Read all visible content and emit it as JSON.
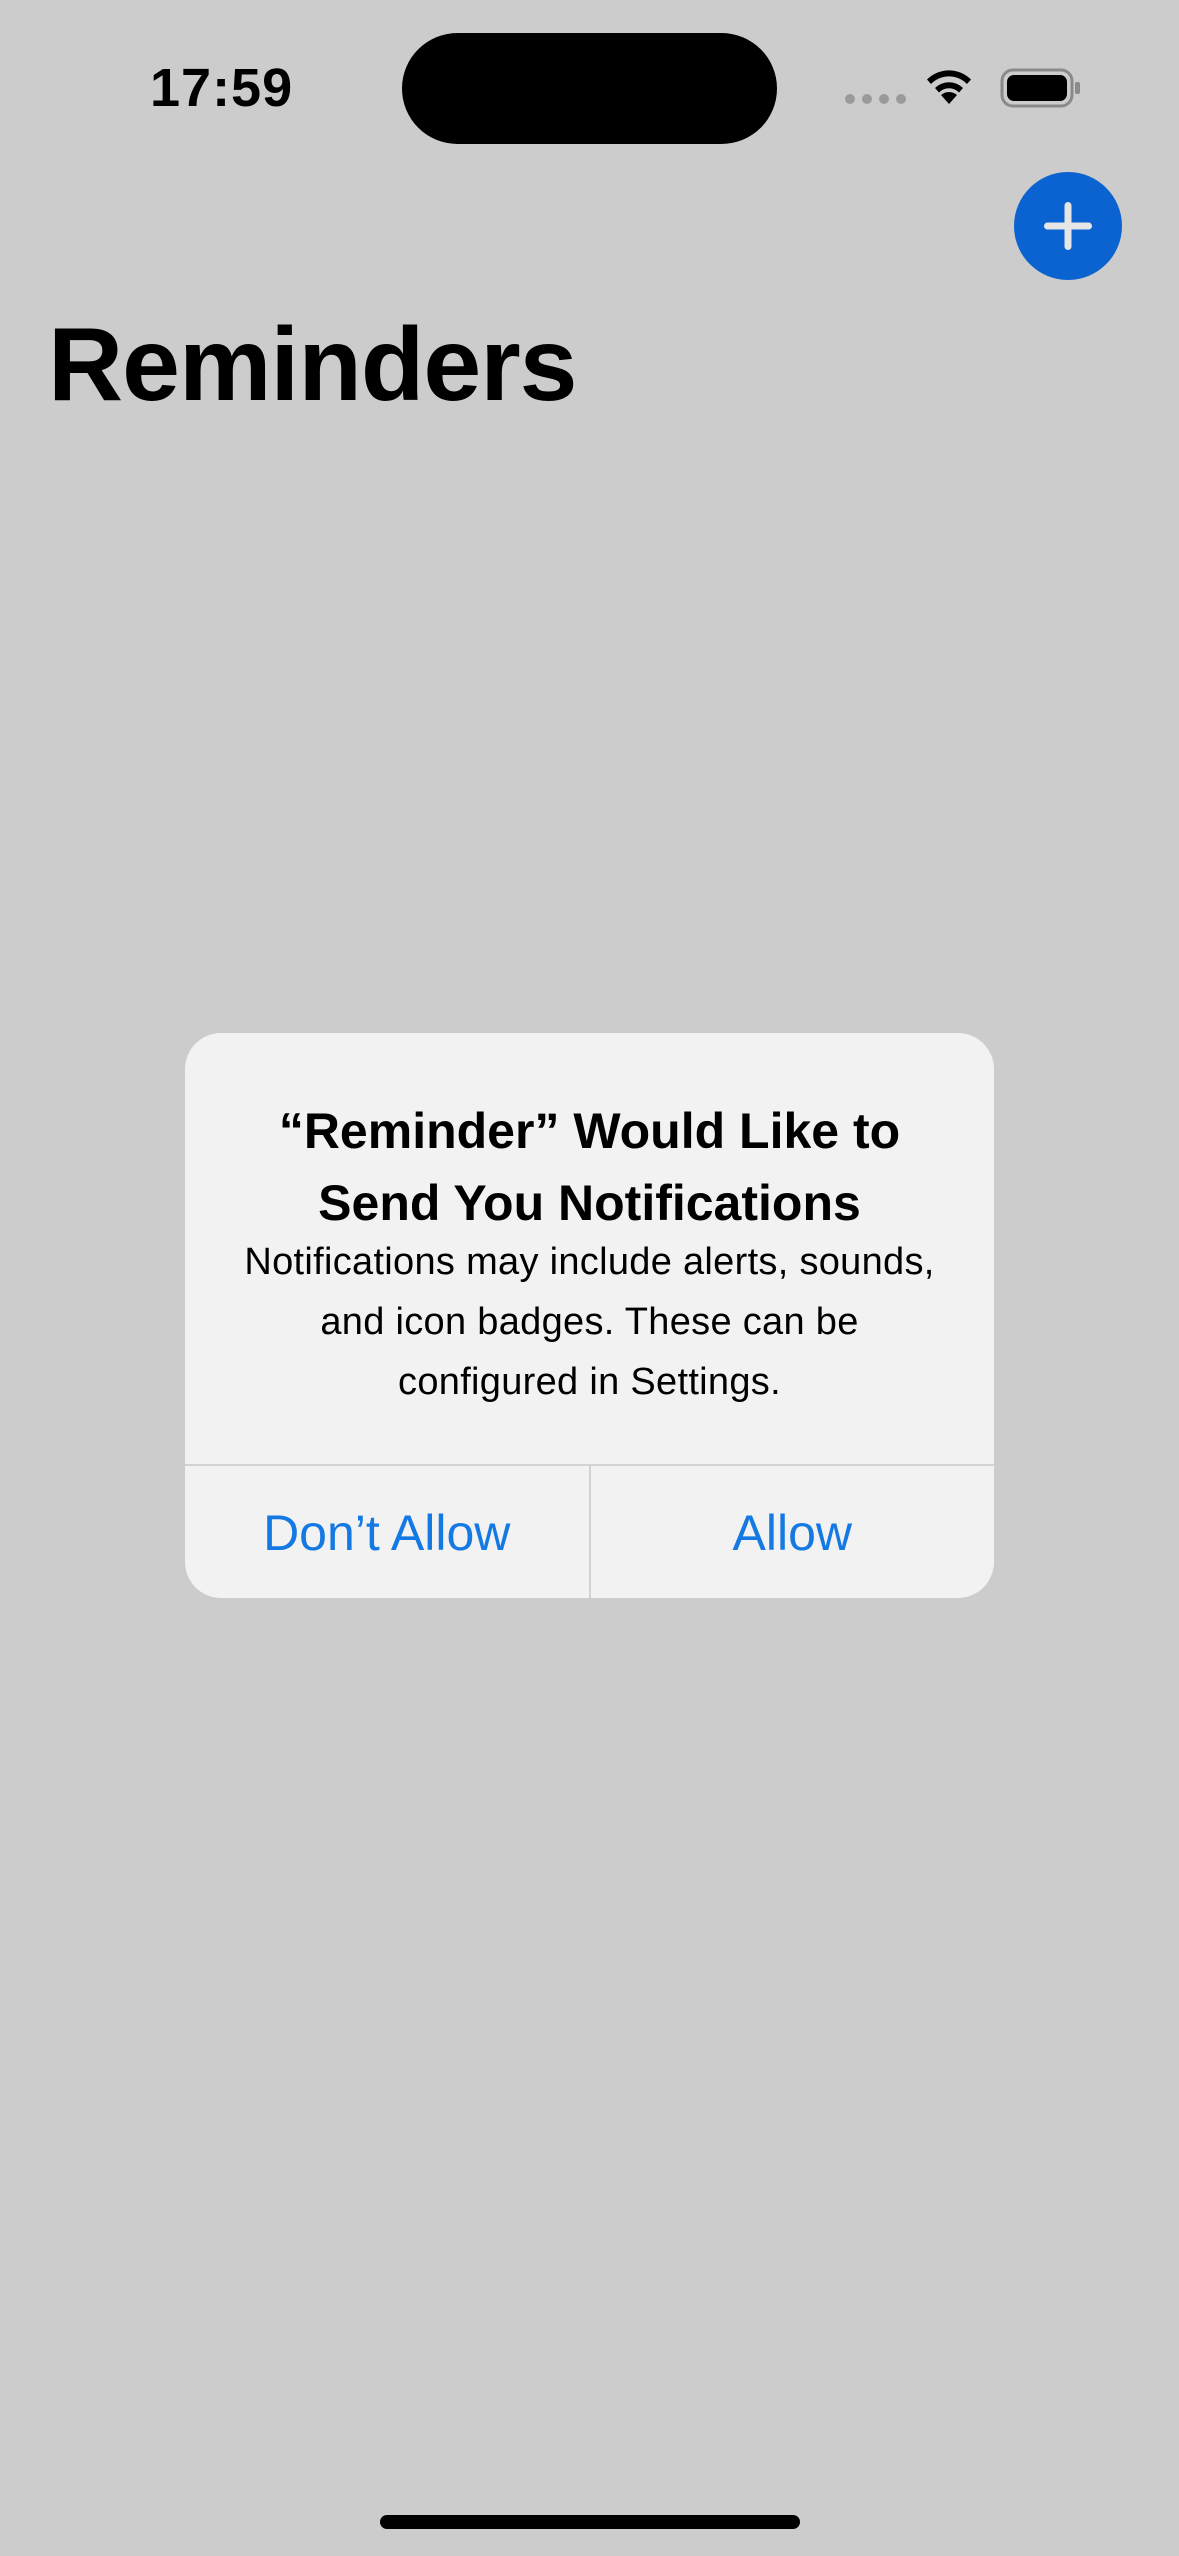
{
  "status_bar": {
    "time": "17:59",
    "icons": [
      "signal-dots-icon",
      "wifi-icon",
      "battery-icon"
    ]
  },
  "nav": {
    "add_icon": "plus-icon",
    "accent_color": "#0a63d0"
  },
  "main": {
    "title": "Reminders"
  },
  "alert": {
    "title": "“Reminder” Would Like to Send You Notifications",
    "message": "Notifications may include alerts, sounds, and icon badges. These can be configured in Settings.",
    "dont_allow_label": "Don’t Allow",
    "allow_label": "Allow",
    "button_color": "#1479e3"
  }
}
